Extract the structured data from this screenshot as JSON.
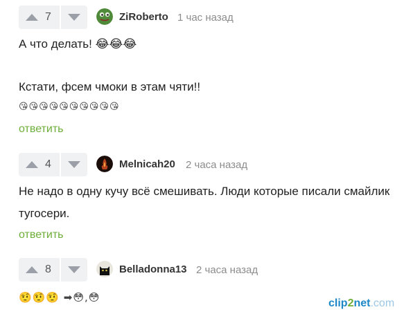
{
  "comments": [
    {
      "score": "7",
      "author": "ZiRoberto",
      "time": "1 час назад",
      "avatar": "frog-avatar-icon",
      "lines": [
        "А что делать! 😂😂😂",
        "Кстати, фсем чмоки в этам чяти!!",
        "😘😘😘😘😘😘😘😘😘😘"
      ],
      "reply": "ответить"
    },
    {
      "score": "4",
      "author": "Melnicah20",
      "time": "2 часа назад",
      "avatar": "dark-fire-avatar-icon",
      "lines": [
        "Не надо в одну кучу всё смешивать. Люди которые писали смайлик",
        "тугосери."
      ],
      "reply": "ответить"
    },
    {
      "score": "8",
      "author": "Belladonna13",
      "time": "2 часа назад",
      "avatar": "black-cat-avatar-icon",
      "lines": [
        "🤨🤨🤨 ➡😳,😳"
      ]
    }
  ],
  "watermark": {
    "part1": "clip",
    "part2": "2",
    "part3": "net",
    "part4": ".com"
  },
  "colors": {
    "reply": "#6dae38",
    "vote_bg": "#f0f1f3",
    "time": "#8c8c8c"
  }
}
